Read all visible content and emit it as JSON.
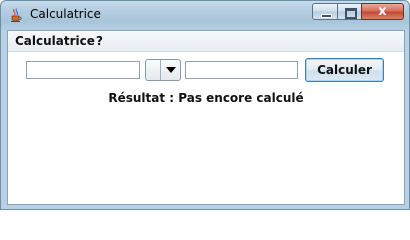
{
  "window": {
    "title": "Calculatrice",
    "icon": "java-cup-icon",
    "controls": {
      "minimize": "minimize-icon",
      "maximize": "maximize-icon",
      "close": "close-icon",
      "close_glyph": "x"
    }
  },
  "menubar": {
    "items": [
      {
        "label": "Calculatrice"
      },
      {
        "label": "?"
      }
    ]
  },
  "form": {
    "left_operand": {
      "value": ""
    },
    "operator": {
      "value": ""
    },
    "right_operand": {
      "value": ""
    },
    "calculate_label": "Calculer"
  },
  "result": {
    "text": "Résultat : Pas encore calculé"
  },
  "colors": {
    "titlebar": "#b4cce0",
    "close_button": "#c44a33",
    "button_border": "#3c7fb1"
  }
}
